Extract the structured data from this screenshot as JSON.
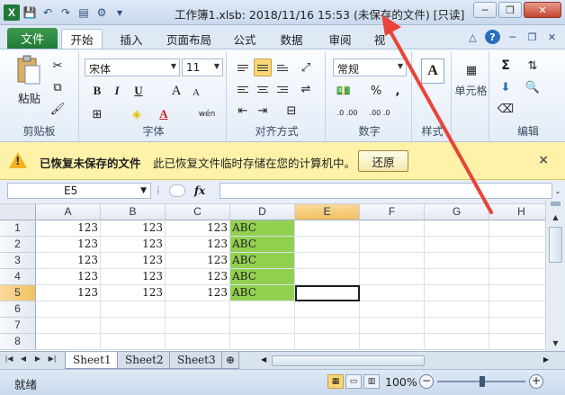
{
  "window": {
    "title": "工作簿1.xlsb: 2018/11/16 15:53 (未保存的文件)  [只读]",
    "minimize": "─",
    "restore": "❐",
    "close": "✕"
  },
  "qat": {
    "logo": "X",
    "icons": [
      "save-icon",
      "undo-icon",
      "redo-icon",
      "print-preview-icon",
      "customize-icon"
    ]
  },
  "tabs": {
    "file": "文件",
    "items": [
      "开始",
      "插入",
      "页面布局",
      "公式",
      "数据",
      "审阅",
      "视"
    ],
    "active": "开始"
  },
  "ribbon": {
    "clipboard": {
      "label": "剪贴板",
      "paste": "粘贴"
    },
    "font": {
      "label": "字体",
      "name": "宋体",
      "size": "11",
      "bold": "B",
      "italic": "I",
      "underline": "U",
      "grow": "A",
      "shrink": "A",
      "wen": "wén"
    },
    "alignment": {
      "label": "对齐方式"
    },
    "number": {
      "label": "数字",
      "format": "常规",
      "percent": "%",
      "comma": ",",
      "inc": ".0 .00",
      "dec": ".00 .0"
    },
    "styles": {
      "label": "样式"
    },
    "cells": {
      "label": "单元格"
    },
    "editing": {
      "label": "编辑",
      "sum": "Σ"
    }
  },
  "notification": {
    "title": "已恢复未保存的文件",
    "message": "此已恢复文件临时存储在您的计算机中。",
    "button": "还原",
    "close": "×"
  },
  "formula_bar": {
    "name_box": "E5",
    "fx": "fx",
    "value": ""
  },
  "grid": {
    "columns": [
      "A",
      "B",
      "C",
      "D",
      "E",
      "F",
      "G",
      "H"
    ],
    "selected_column": "E",
    "selected_row": "5",
    "rows": [
      {
        "n": "1",
        "cells": [
          "123",
          "123",
          "123",
          "ABC",
          "",
          "",
          "",
          ""
        ]
      },
      {
        "n": "2",
        "cells": [
          "123",
          "123",
          "123",
          "ABC",
          "",
          "",
          "",
          ""
        ]
      },
      {
        "n": "3",
        "cells": [
          "123",
          "123",
          "123",
          "ABC",
          "",
          "",
          "",
          ""
        ]
      },
      {
        "n": "4",
        "cells": [
          "123",
          "123",
          "123",
          "ABC",
          "",
          "",
          "",
          ""
        ]
      },
      {
        "n": "5",
        "cells": [
          "123",
          "123",
          "123",
          "ABC",
          "",
          "",
          "",
          ""
        ]
      },
      {
        "n": "6",
        "cells": [
          "",
          "",
          "",
          "",
          "",
          "",
          "",
          ""
        ]
      },
      {
        "n": "7",
        "cells": [
          "",
          "",
          "",
          "",
          "",
          "",
          "",
          ""
        ]
      },
      {
        "n": "8",
        "cells": [
          "",
          "",
          "",
          "",
          "",
          "",
          "",
          ""
        ]
      }
    ],
    "highlight_color": "#92d050"
  },
  "sheets": {
    "tabs": [
      "Sheet1",
      "Sheet2",
      "Sheet3"
    ],
    "active": "Sheet1"
  },
  "status": {
    "ready": "就绪",
    "zoom": "100%",
    "zoom_out": "−",
    "zoom_in": "+"
  },
  "annotation": {
    "arrow_color": "#e8443a"
  }
}
